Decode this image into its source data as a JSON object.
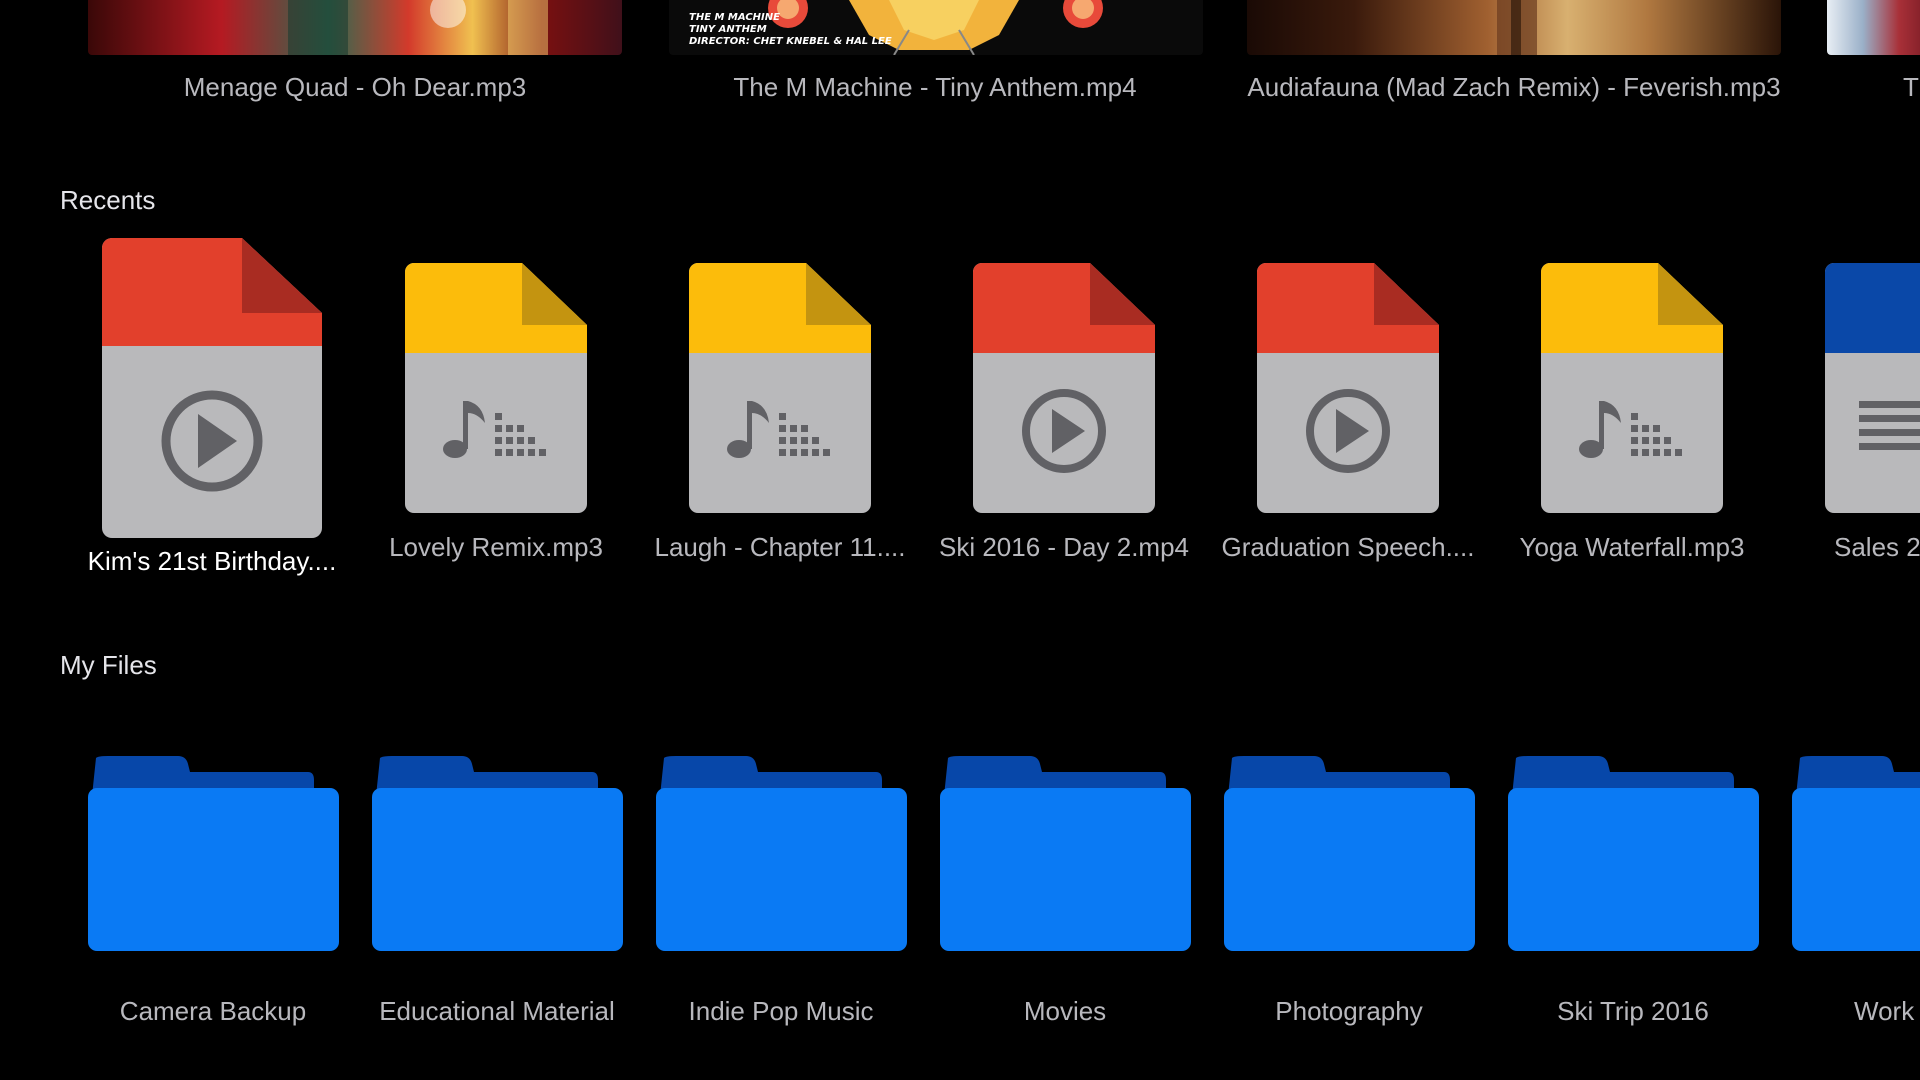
{
  "featured": {
    "items": [
      {
        "caption": "Menage Quad - Oh Dear.mp3"
      },
      {
        "caption": "The M Machine - Tiny Anthem.mp4",
        "poster_lines": [
          "THE M MACHINE",
          "TINY ANTHEM",
          "DIRECTOR: CHET KNEBEL & HAL LEE"
        ]
      },
      {
        "caption": "Audiafauna (Mad Zach Remix) - Feverish.mp3"
      },
      {
        "caption": "Th"
      }
    ]
  },
  "recents": {
    "title": "Recents",
    "items": [
      {
        "name": "Kim's 21st Birthday....",
        "kind": "video",
        "color": "#e2402c"
      },
      {
        "name": "Lovely Remix.mp3",
        "kind": "audio",
        "color": "#fcbc0b"
      },
      {
        "name": "Laugh - Chapter 11....",
        "kind": "audio",
        "color": "#fcbc0b"
      },
      {
        "name": "Ski 2016 - Day 2.mp4",
        "kind": "video",
        "color": "#e2402c"
      },
      {
        "name": "Graduation Speech....",
        "kind": "video",
        "color": "#e2402c"
      },
      {
        "name": "Yoga Waterfall.mp3",
        "kind": "audio",
        "color": "#fcbc0b"
      },
      {
        "name": "Sales 2",
        "kind": "document",
        "color": "#0a48a8"
      }
    ]
  },
  "my_files": {
    "title": "My Files",
    "folders": [
      {
        "name": "Camera Backup"
      },
      {
        "name": "Educational Material"
      },
      {
        "name": "Indie Pop Music"
      },
      {
        "name": "Movies"
      },
      {
        "name": "Photography"
      },
      {
        "name": "Ski Trip 2016"
      },
      {
        "name": "Work"
      }
    ]
  },
  "colors": {
    "background": "#000000",
    "folder_front": "#0a7af4",
    "folder_back": "#0747a9",
    "doc_body": "#b9b9bb",
    "doc_glyph": "#616165",
    "video_color": "#e2402c",
    "audio_color": "#fcbc0b",
    "document_color": "#0a48a8"
  }
}
